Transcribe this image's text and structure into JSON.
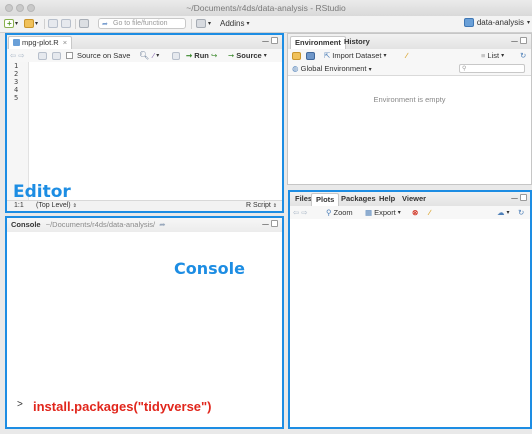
{
  "window": {
    "title": "~/Documents/r4ds/data-analysis - RStudio"
  },
  "toolbar": {
    "goto_placeholder": "Go to file/function",
    "addins_label": "Addins",
    "project_label": "data-analysis"
  },
  "editor": {
    "tab_label": "mpg-plot.R",
    "source_on_save": "Source on Save",
    "run_label": "Run",
    "source_label": "Source",
    "line_numbers": [
      "1",
      "2",
      "3",
      "4",
      "5"
    ],
    "cursor_pos": "1:1",
    "scope": "(Top Level)",
    "file_type": "R Script",
    "overlay_label": "Editor"
  },
  "console": {
    "tab_label": "Console",
    "path": "~/Documents/r4ds/data-analysis/",
    "overlay_label": "Console",
    "prompt": ">",
    "command": "install.packages(\"tidyverse\")"
  },
  "environment": {
    "tabs": [
      "Environment",
      "History"
    ],
    "import_label": "Import Dataset",
    "list_label": "List",
    "scope_label": "Global Environment",
    "empty_message": "Environment is empty"
  },
  "files": {
    "tabs": [
      "Files",
      "Plots",
      "Packages",
      "Help",
      "Viewer"
    ],
    "zoom_label": "Zoom",
    "export_label": "Export"
  },
  "colors": {
    "highlight": "#1d8de3",
    "command": "#e1261c"
  }
}
